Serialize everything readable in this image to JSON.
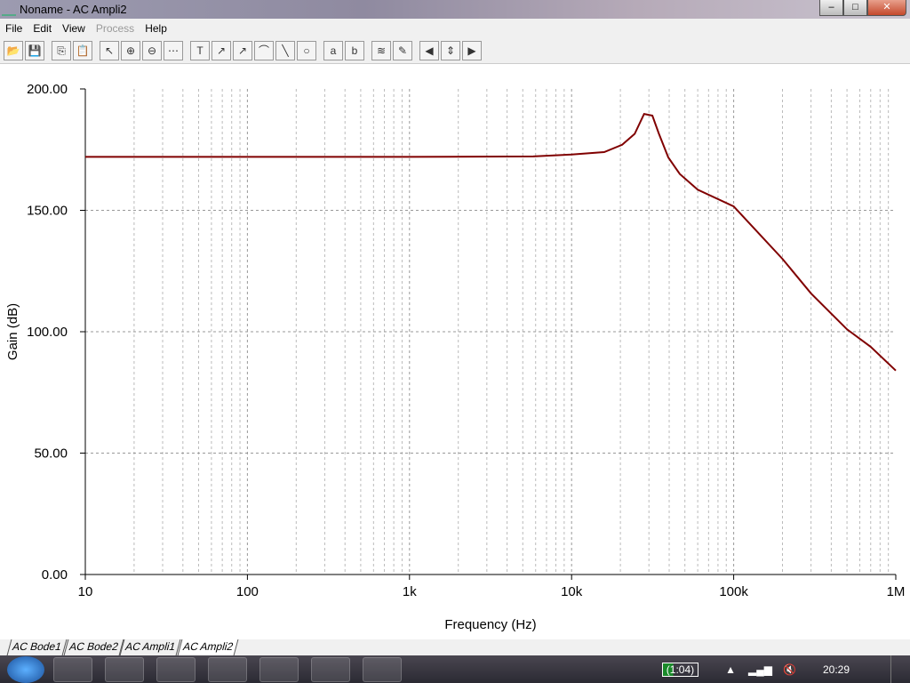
{
  "window": {
    "title": "Noname - AC Ampli2",
    "minimize": "–",
    "maximize": "□",
    "close": "✕"
  },
  "menu": [
    "File",
    "Edit",
    "View",
    "Process",
    "Help"
  ],
  "toolbar": [
    {
      "icon": "open-folder-icon",
      "g": "📂"
    },
    {
      "icon": "save-icon",
      "g": "💾"
    },
    {
      "icon": "copy-icon",
      "g": "⎘"
    },
    {
      "icon": "paste-icon",
      "g": "📋"
    },
    {
      "icon": "pointer-icon",
      "g": "↖"
    },
    {
      "icon": "zoom-in-icon",
      "g": "⊕"
    },
    {
      "icon": "zoom-100-icon",
      "g": "⊖"
    },
    {
      "icon": "grid-icon",
      "g": "⋯"
    },
    {
      "icon": "text-icon",
      "g": "T"
    },
    {
      "icon": "annotate-icon",
      "g": "↗"
    },
    {
      "icon": "annotate-query-icon",
      "g": "↗"
    },
    {
      "icon": "curve-label-icon",
      "g": "⌒"
    },
    {
      "icon": "line-icon",
      "g": "╲"
    },
    {
      "icon": "circle-icon",
      "g": "○"
    },
    {
      "icon": "cursor-a-icon",
      "g": "a"
    },
    {
      "icon": "cursor-b-icon",
      "g": "b"
    },
    {
      "icon": "add-curves-icon",
      "g": "≋"
    },
    {
      "icon": "add-probe-icon",
      "g": "✎"
    },
    {
      "icon": "arrow-left-icon",
      "g": "◀"
    },
    {
      "icon": "arrow-updown-icon",
      "g": "⇕"
    },
    {
      "icon": "arrow-right-icon",
      "g": "▶"
    }
  ],
  "tabs": [
    "AC Bode1",
    "AC Bode2",
    "AC Ampli1",
    "AC Ampli2"
  ],
  "active_tab": 3,
  "taskbar": {
    "apps": [
      "firefox-icon",
      "explorer-icon",
      "onenote-icon",
      "outlook-icon",
      "word-icon",
      "acrobat-icon",
      "tina-icon"
    ],
    "battery": "(1:04)",
    "clock": "20:29"
  },
  "chart_data": {
    "type": "line",
    "xlabel": "Frequency (Hz)",
    "ylabel": "Gain (dB)",
    "xscale": "log",
    "xlim": [
      10,
      1000000
    ],
    "ylim": [
      0,
      200
    ],
    "xticks": [
      10,
      100,
      1000,
      10000,
      100000,
      1000000
    ],
    "xtick_labels": [
      "10",
      "100",
      "1k",
      "10k",
      "100k",
      "1M"
    ],
    "yticks": [
      0,
      50,
      100,
      150,
      200
    ],
    "ytick_labels": [
      "0.00",
      "50.00",
      "100.00",
      "150.00",
      "200.00"
    ],
    "grid": true,
    "color": "#800000",
    "series": [
      {
        "name": "Gain",
        "x": [
          10,
          1000,
          5800,
          10000,
          15900,
          20500,
          24500,
          28000,
          31500,
          34500,
          39500,
          46500,
          60000,
          100000,
          200000,
          300000,
          500000,
          700000,
          1000000
        ],
        "y": [
          172,
          172,
          172.2,
          173,
          174,
          177,
          181.5,
          189.7,
          189,
          181.7,
          171.8,
          165,
          158.5,
          151.6,
          130,
          115.8,
          101,
          93.8,
          84
        ]
      }
    ]
  }
}
